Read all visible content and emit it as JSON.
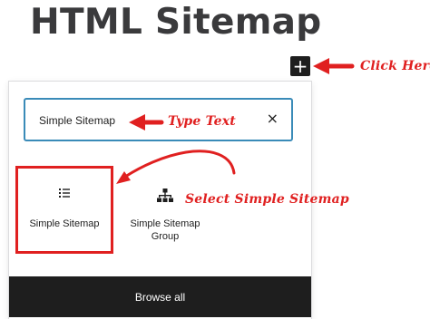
{
  "page": {
    "title": "HTML Sitemap"
  },
  "toolbar": {
    "add_symbol": "+"
  },
  "inserter": {
    "search": {
      "value": "Simple Sitemap",
      "clear_symbol": "×"
    },
    "blocks": [
      {
        "label": "Simple Sitemap",
        "icon": "list-icon"
      },
      {
        "label_line1": "Simple Sitemap",
        "label_line2": "Group",
        "icon": "sitemap-icon"
      }
    ],
    "browse_all": "Browse all"
  },
  "annotations": {
    "click_here": "Click Here",
    "type_text": "Type Text",
    "select": "Select Simple Sitemap",
    "color": "#e02020"
  }
}
